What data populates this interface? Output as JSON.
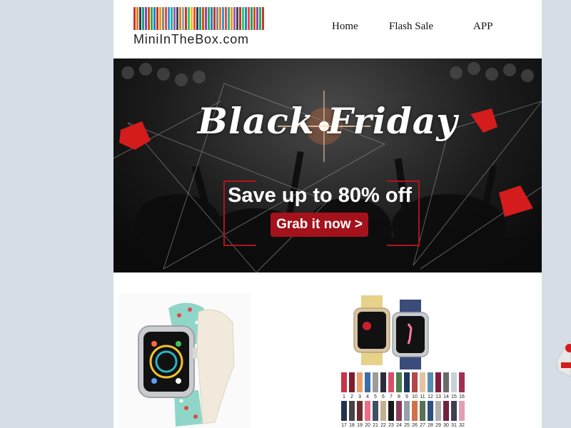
{
  "header": {
    "logo_text": "MiniInTheBox.com",
    "barcode_colors": [
      "#c0392b",
      "#e67e22",
      "#2c3e50",
      "#16a085",
      "#8e44ad",
      "#d35400",
      "#27ae60",
      "#2980b9",
      "#c0392b",
      "#f39c12",
      "#7f8c8d",
      "#e74c3c",
      "#3498db",
      "#1abc9c",
      "#9b59b6",
      "#34495e",
      "#e67e22",
      "#95a5a6",
      "#c0392b",
      "#2ecc71",
      "#f1c40f",
      "#e74c3c",
      "#2c3e50",
      "#16a085",
      "#d35400",
      "#8e44ad",
      "#27ae60",
      "#2980b9",
      "#c0392b",
      "#7f8c8d",
      "#e67e22",
      "#3498db",
      "#e74c3c",
      "#1abc9c",
      "#f39c12",
      "#9b59b6",
      "#34495e",
      "#c0392b",
      "#2ecc71",
      "#2980b9",
      "#e74c3c",
      "#16a085",
      "#d35400",
      "#8e44ad",
      "#27ae60",
      "#c0392b"
    ],
    "nav": [
      "Home",
      "Flash Sale",
      "APP"
    ]
  },
  "banner": {
    "title": "Black Friday",
    "subtitle": "Save up to 80% off",
    "cta": "Grab it now >"
  },
  "products": {
    "swatch_numbers_row1": [
      "1",
      "2",
      "3",
      "4",
      "5",
      "6",
      "7",
      "8",
      "9",
      "10",
      "11",
      "12",
      "13",
      "14",
      "15",
      "16"
    ],
    "swatch_numbers_row2": [
      "17",
      "18",
      "19",
      "20",
      "21",
      "22",
      "23",
      "24",
      "25",
      "26",
      "27",
      "28",
      "29",
      "30",
      "31",
      "32"
    ],
    "swatch_colors_row1": [
      "#c7354a",
      "#7a1f2e",
      "#e8a070",
      "#3a6ea5",
      "#9c9c9c",
      "#2b2b3a",
      "#d94e68",
      "#4c7f4c",
      "#1f3a5a",
      "#b34848",
      "#e2c5a0",
      "#5a8fb0",
      "#802040",
      "#6a6a6a",
      "#c9d2d8",
      "#a03050"
    ],
    "swatch_colors_row2": [
      "#22334d",
      "#444444",
      "#6b2c2c",
      "#ef6c8a",
      "#405060",
      "#c4b090",
      "#1a1a1a",
      "#8a3b5c",
      "#96a0a8",
      "#d3704a",
      "#5b7055",
      "#2d4f7c",
      "#b0b0b0",
      "#722040",
      "#3f3f52",
      "#e0a0b0"
    ],
    "colors": {
      "accent": "#a4121b",
      "background": "#d6dde5"
    }
  }
}
